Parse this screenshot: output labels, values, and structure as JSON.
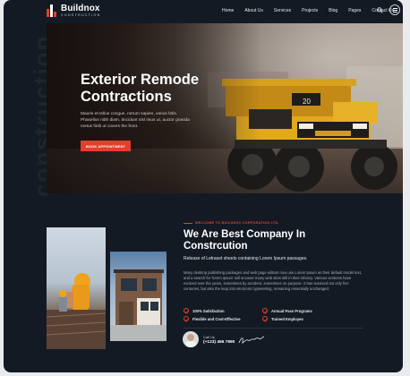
{
  "header": {
    "brand_name": "Buildnox",
    "brand_sub": "CONSTRUCTION",
    "nav": [
      "Home",
      "About Us",
      "Services",
      "Projects",
      "Blog",
      "Pages",
      "Contact Us"
    ],
    "search_icon": "search-icon",
    "menu_icon": "hamburger-menu-icon"
  },
  "hero": {
    "watermark": "construction",
    "title_line1": "Exterior Remode",
    "title_line2": "Contractions",
    "description": "Mauris et tellus congue, rutrum sapien, varius felis. Phasellus nibh diam, tincidunt nisl risus ut, auctor gravida metus finib ut covers the front.",
    "button_label": "BOOK APPOINTMENT"
  },
  "about": {
    "eyebrow": "WELCOME TO BUILDNOX CORPORATION LTD.",
    "title_line1": "We Are Best Company In",
    "title_line2": "Constrcution",
    "lead": "Release of Letraset sheets containing Lorem Ipsum passages.",
    "body": "Many desktop publishing packages and web page editors now use Lorem Ipsum as their default model text, and a search for 'lorem ipsum' will uncover many web sites still in their infancy. Various versions have evolved over the years, sometimes by accident, sometimes on purpose. It has survived not only five centuries, but also the leap into electronic typesetting, remaining essentially unchanged.",
    "features": [
      "100% Satisfaction",
      "Annual Pass Programs",
      "Flexible and Cost-Effective",
      "Trained Employes"
    ],
    "call_label": "Call Us",
    "call_number": "(+123) 456 7890",
    "accent_color": "#e2402c"
  }
}
